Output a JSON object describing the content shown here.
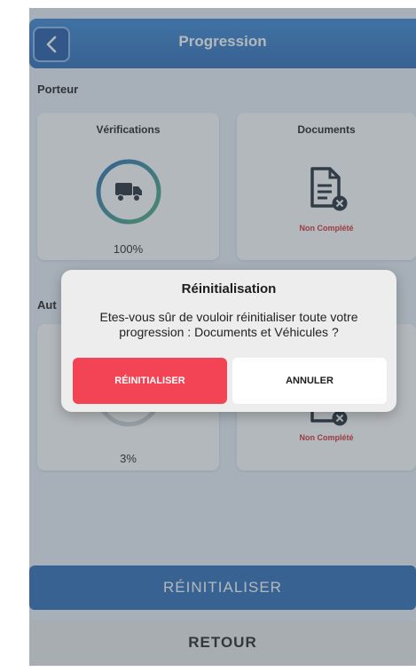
{
  "header": {
    "title": "Progression"
  },
  "sections": {
    "porteur": "Porteur",
    "autre": "Aut"
  },
  "cards": {
    "verifications_title": "Vérifications",
    "verifications_pct": "100%",
    "verifications_progress": 1.0,
    "documents_title": "Documents",
    "documents_status": "Non Complété",
    "auto_pct": "3%",
    "auto_progress": 0.03,
    "auto_docs_status": "Non Complété"
  },
  "buttons": {
    "reset": "RÉINITIALISER",
    "back": "RETOUR"
  },
  "dialog": {
    "title": "Réinitialisation",
    "message": "Etes-vous sûr de vouloir réinitialiser toute votre progression : Documents et Véhicules ?",
    "confirm": "RÉINITIALISER",
    "cancel": "ANNULER"
  },
  "colors": {
    "primary": "#2a6bb7",
    "danger": "#f24455",
    "status_red": "#d32b2b"
  },
  "icons": {
    "back": "chevron-left-icon",
    "truck": "truck-icon",
    "document_error": "document-x-icon"
  }
}
